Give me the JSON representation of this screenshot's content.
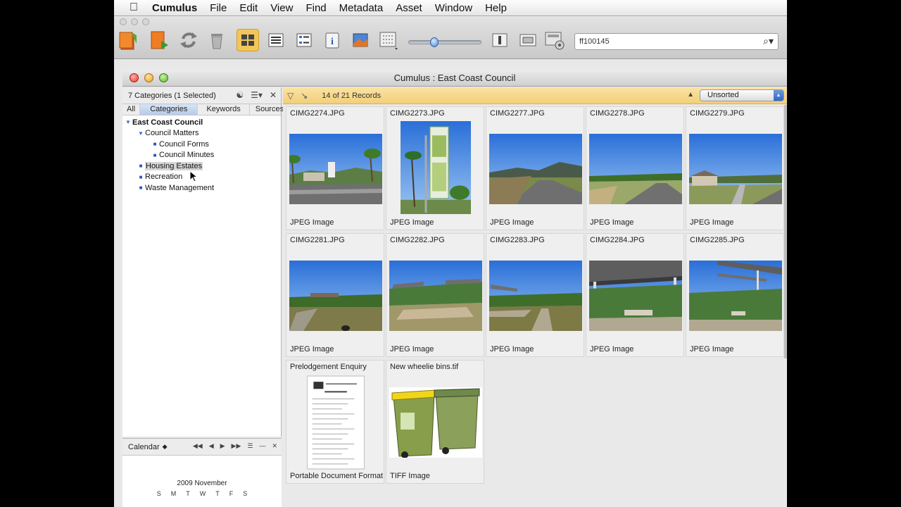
{
  "menubar": {
    "app": "Cumulus",
    "items": [
      "File",
      "Edit",
      "View",
      "Find",
      "Metadata",
      "Asset",
      "Window",
      "Help"
    ]
  },
  "toolbar": {
    "search_value": "ff100145",
    "buttons": [
      "add-assets-icon",
      "add-catalog-icon",
      "sync-icon",
      "trash-icon",
      "thumbnail-view-icon",
      "list-view-icon",
      "details-view-icon",
      "info-icon",
      "preview-icon",
      "layout-icon",
      "inspector-icon",
      "slideshow-icon",
      "settings-icon"
    ]
  },
  "window": {
    "title": "Cumulus : East Coast Council"
  },
  "categories": {
    "header": "7 Categories (1 Selected)",
    "tabs": [
      "All",
      "Categories",
      "Keywords",
      "Sources"
    ],
    "selected_tab": "Categories",
    "tree": [
      {
        "label": "East Coast Council",
        "level": 0,
        "expanded": true,
        "bold": true
      },
      {
        "label": "Council Matters",
        "level": 1,
        "expanded": true
      },
      {
        "label": "Council Forms",
        "level": 2
      },
      {
        "label": "Council Minutes",
        "level": 2
      },
      {
        "label": "Housing Estates",
        "level": 1,
        "selected": true
      },
      {
        "label": "Recreation",
        "level": 1
      },
      {
        "label": "Waste Management",
        "level": 1
      }
    ]
  },
  "calendar": {
    "title": "Calendar",
    "month": "2009 November",
    "days": [
      "S",
      "M",
      "T",
      "W",
      "T",
      "F",
      "S"
    ]
  },
  "gallery": {
    "count": "14 of 21 Records",
    "sort": "Unsorted",
    "items": [
      {
        "name": "CIMG2274.JPG",
        "type": "JPEG Image",
        "thumb": "housing-street"
      },
      {
        "name": "CIMG2273.JPG",
        "type": "JPEG Image",
        "thumb": "sign-portrait"
      },
      {
        "name": "CIMG2277.JPG",
        "type": "JPEG Image",
        "thumb": "road-hills"
      },
      {
        "name": "CIMG2278.JPG",
        "type": "JPEG Image",
        "thumb": "road-field"
      },
      {
        "name": "CIMG2279.JPG",
        "type": "JPEG Image",
        "thumb": "house-road"
      },
      {
        "name": "CIMG2281.JPG",
        "type": "JPEG Image",
        "thumb": "park-path"
      },
      {
        "name": "CIMG2282.JPG",
        "type": "JPEG Image",
        "thumb": "picnic-shelters"
      },
      {
        "name": "CIMG2283.JPG",
        "type": "JPEG Image",
        "thumb": "park-path-shelter"
      },
      {
        "name": "CIMG2284.JPG",
        "type": "JPEG Image",
        "thumb": "shelter-close"
      },
      {
        "name": "CIMG2285.JPG",
        "type": "JPEG Image",
        "thumb": "shelter-side"
      },
      {
        "name": "Prelodgement Enquiry",
        "type": "Portable Document Format",
        "thumb": "document"
      },
      {
        "name": "New wheelie bins.tif",
        "type": "TIFF Image",
        "thumb": "wheelie-bins"
      }
    ]
  },
  "colors": {
    "accent": "#f2c65a",
    "selection": "#d6e4f6",
    "sky": "#3a7de0",
    "grass": "#6f8a3a"
  }
}
